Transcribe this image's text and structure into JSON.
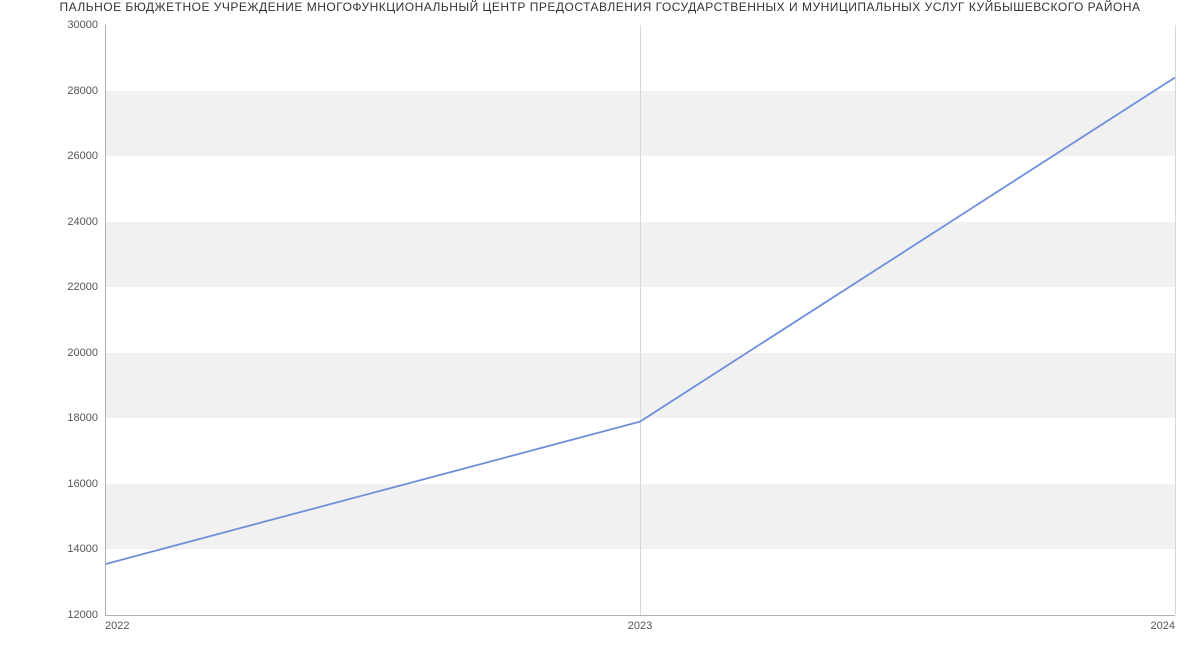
{
  "chart_data": {
    "type": "line",
    "title": "ПАЛЬНОЕ БЮДЖЕТНОЕ УЧРЕЖДЕНИЕ МНОГОФУНКЦИОНАЛЬНЫЙ ЦЕНТР ПРЕДОСТАВЛЕНИЯ ГОСУДАРСТВЕННЫХ И МУНИЦИПАЛЬНЫХ УСЛУГ КУЙБЫШЕВСКОГО РАЙОНА",
    "x": [
      2022,
      2023,
      2024
    ],
    "values": [
      13550,
      17900,
      28400
    ],
    "xlabel": "",
    "ylabel": "",
    "ylim": [
      12000,
      30000
    ],
    "xlim": [
      2022,
      2024
    ],
    "y_ticks": [
      12000,
      14000,
      16000,
      18000,
      20000,
      22000,
      24000,
      26000,
      28000,
      30000
    ],
    "x_ticks": [
      2022,
      2023,
      2024
    ],
    "line_color": "#6e8fdb",
    "band_color": "#f1f1f1"
  }
}
